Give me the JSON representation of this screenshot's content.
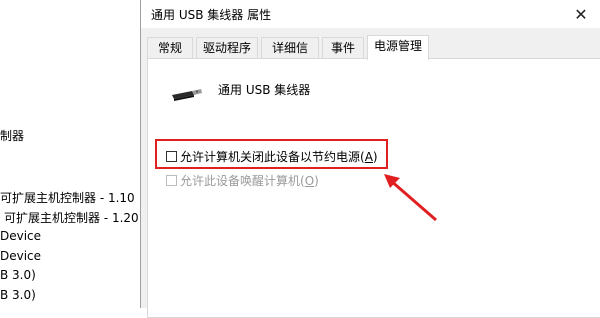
{
  "background_list": {
    "items": [
      "制器",
      "可扩展主机控制器 - 1.10",
      "可扩展主机控制器 - 1.20",
      "Device",
      "Device",
      "B 3.0)",
      "B 3.0)"
    ]
  },
  "dialog": {
    "title": "通用 USB 集线器 属性",
    "close_symbol": "✕",
    "tabs": [
      {
        "label": "常规"
      },
      {
        "label": "驱动程序"
      },
      {
        "label": "详细信息"
      },
      {
        "label": "事件"
      },
      {
        "label": "电源管理"
      }
    ],
    "active_tab": "电源管理",
    "device_name": "通用 USB 集线器",
    "options": {
      "allow_turn_off": {
        "text": "允许计算机关闭此设备以节约电源",
        "accel": "A",
        "checked": false,
        "enabled": true
      },
      "allow_wake": {
        "text": "允许此设备唤醒计算机",
        "accel": "O",
        "checked": false,
        "enabled": false
      }
    }
  },
  "annotation": {
    "highlight_color": "#e02020",
    "arrow_color": "#e02020"
  }
}
